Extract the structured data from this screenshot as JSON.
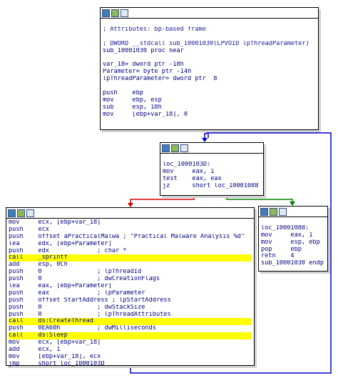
{
  "colors": {
    "edge_true": "#008000",
    "edge_false": "#d00000",
    "edge_jump": "#0000c8"
  },
  "icons": [
    "graph-color-icon",
    "graph-chart-icon",
    "graph-text-icon"
  ],
  "block1": {
    "lines": [
      "",
      "; Attributes: bp-based frame",
      "",
      "; DWORD __stdcall sub_10001030(LPVOID lpThreadParameter)",
      "sub_10001030 proc near",
      "",
      "var_18= dword ptr -18h",
      "Parameter= byte ptr -14h",
      "lpThreadParameter= dword ptr  8",
      "",
      "push    ebp",
      "mov     ebp, esp",
      "sub     esp, 18h",
      "mov     [ebp+var_18], 0"
    ]
  },
  "block2": {
    "lines": [
      "loc_1000103D:",
      "mov     eax, 1",
      "test    eax, eax",
      "jz      short loc_10001088"
    ]
  },
  "block3": {
    "lines": [
      "mov     ecx, [ebp+var_18]",
      "push    ecx",
      "push    offset aPracticalMalwa ; \"Practical Malware Analysis %d\"",
      "lea     edx, [ebp+Parameter]",
      "push    edx             ; char *",
      "call    _sprintf",
      "add     esp, 0Ch",
      "push    0               ; lpThreadId",
      "push    0               ; dwCreationFlags",
      "lea     eax, [ebp+Parameter]",
      "push    eax             ; lpParameter",
      "push    offset StartAddress ; lpStartAddress",
      "push    0               ; dwStackSize",
      "push    0               ; lpThreadAttributes",
      "call    ds:CreateThread",
      "push    0EA60h          ; dwMilliseconds",
      "call    ds:Sleep",
      "mov     ecx, [ebp+var_18]",
      "add     ecx, 1",
      "mov     [ebp+var_18], ecx",
      "jmp     short loc_1000103D"
    ]
  },
  "block4": {
    "lines": [
      "",
      "loc_10001088:",
      "mov     eax, 1",
      "mov     esp, ebp",
      "pop     ebp",
      "retn    4",
      "sub_10001030 endp"
    ]
  }
}
